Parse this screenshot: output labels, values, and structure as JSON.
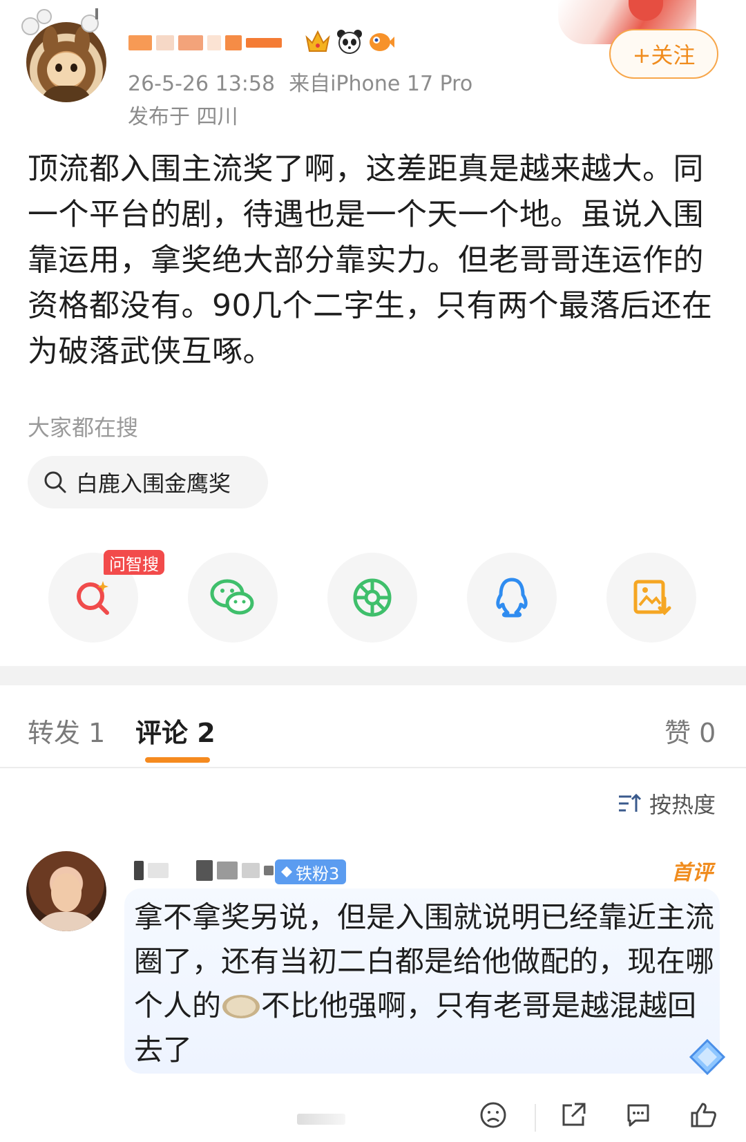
{
  "post": {
    "meta_date": "26-5-26 13:58",
    "meta_source": "来自iPhone 17 Pro",
    "location": "发布于 四川",
    "follow_label": "+关注",
    "text": "顶流都入围主流奖了啊，这差距真是越来越大。同一个平台的剧，待遇也是一个天一个地。虽说入围靠运用，拿奖绝大部分靠实力。但老哥哥连运作的资格都没有。90几个二字生，只有两个最落后还在为破落武侠互啄。"
  },
  "hot_search": {
    "label": "大家都在搜",
    "query": "白鹿入围金鹰奖"
  },
  "share": {
    "badge": "问智搜",
    "icons": [
      "search-ai-icon",
      "wechat-icon",
      "moments-icon",
      "qq-icon",
      "save-image-icon"
    ]
  },
  "tabs": {
    "repost": "转发 1",
    "comment": "评论 2",
    "like": "赞 0"
  },
  "sort_label": "按热度",
  "comment": {
    "fan_badge": "铁粉3",
    "first_tag": "首评",
    "text_before_emoji": "拿不拿奖另说，但是入围就说明已经靠近主流圈了，还有当初二白都是给他做配的，现在哪个人的",
    "text_after_emoji": "不比他强啊，只有老哥是越混越回去了"
  },
  "colors": {
    "accent_orange": "#f08c1e",
    "badge_red": "#f24b4b",
    "wechat_green": "#3fbf6b",
    "qq_blue": "#2f8cf0",
    "fan_badge_blue": "#5b9cf0"
  }
}
